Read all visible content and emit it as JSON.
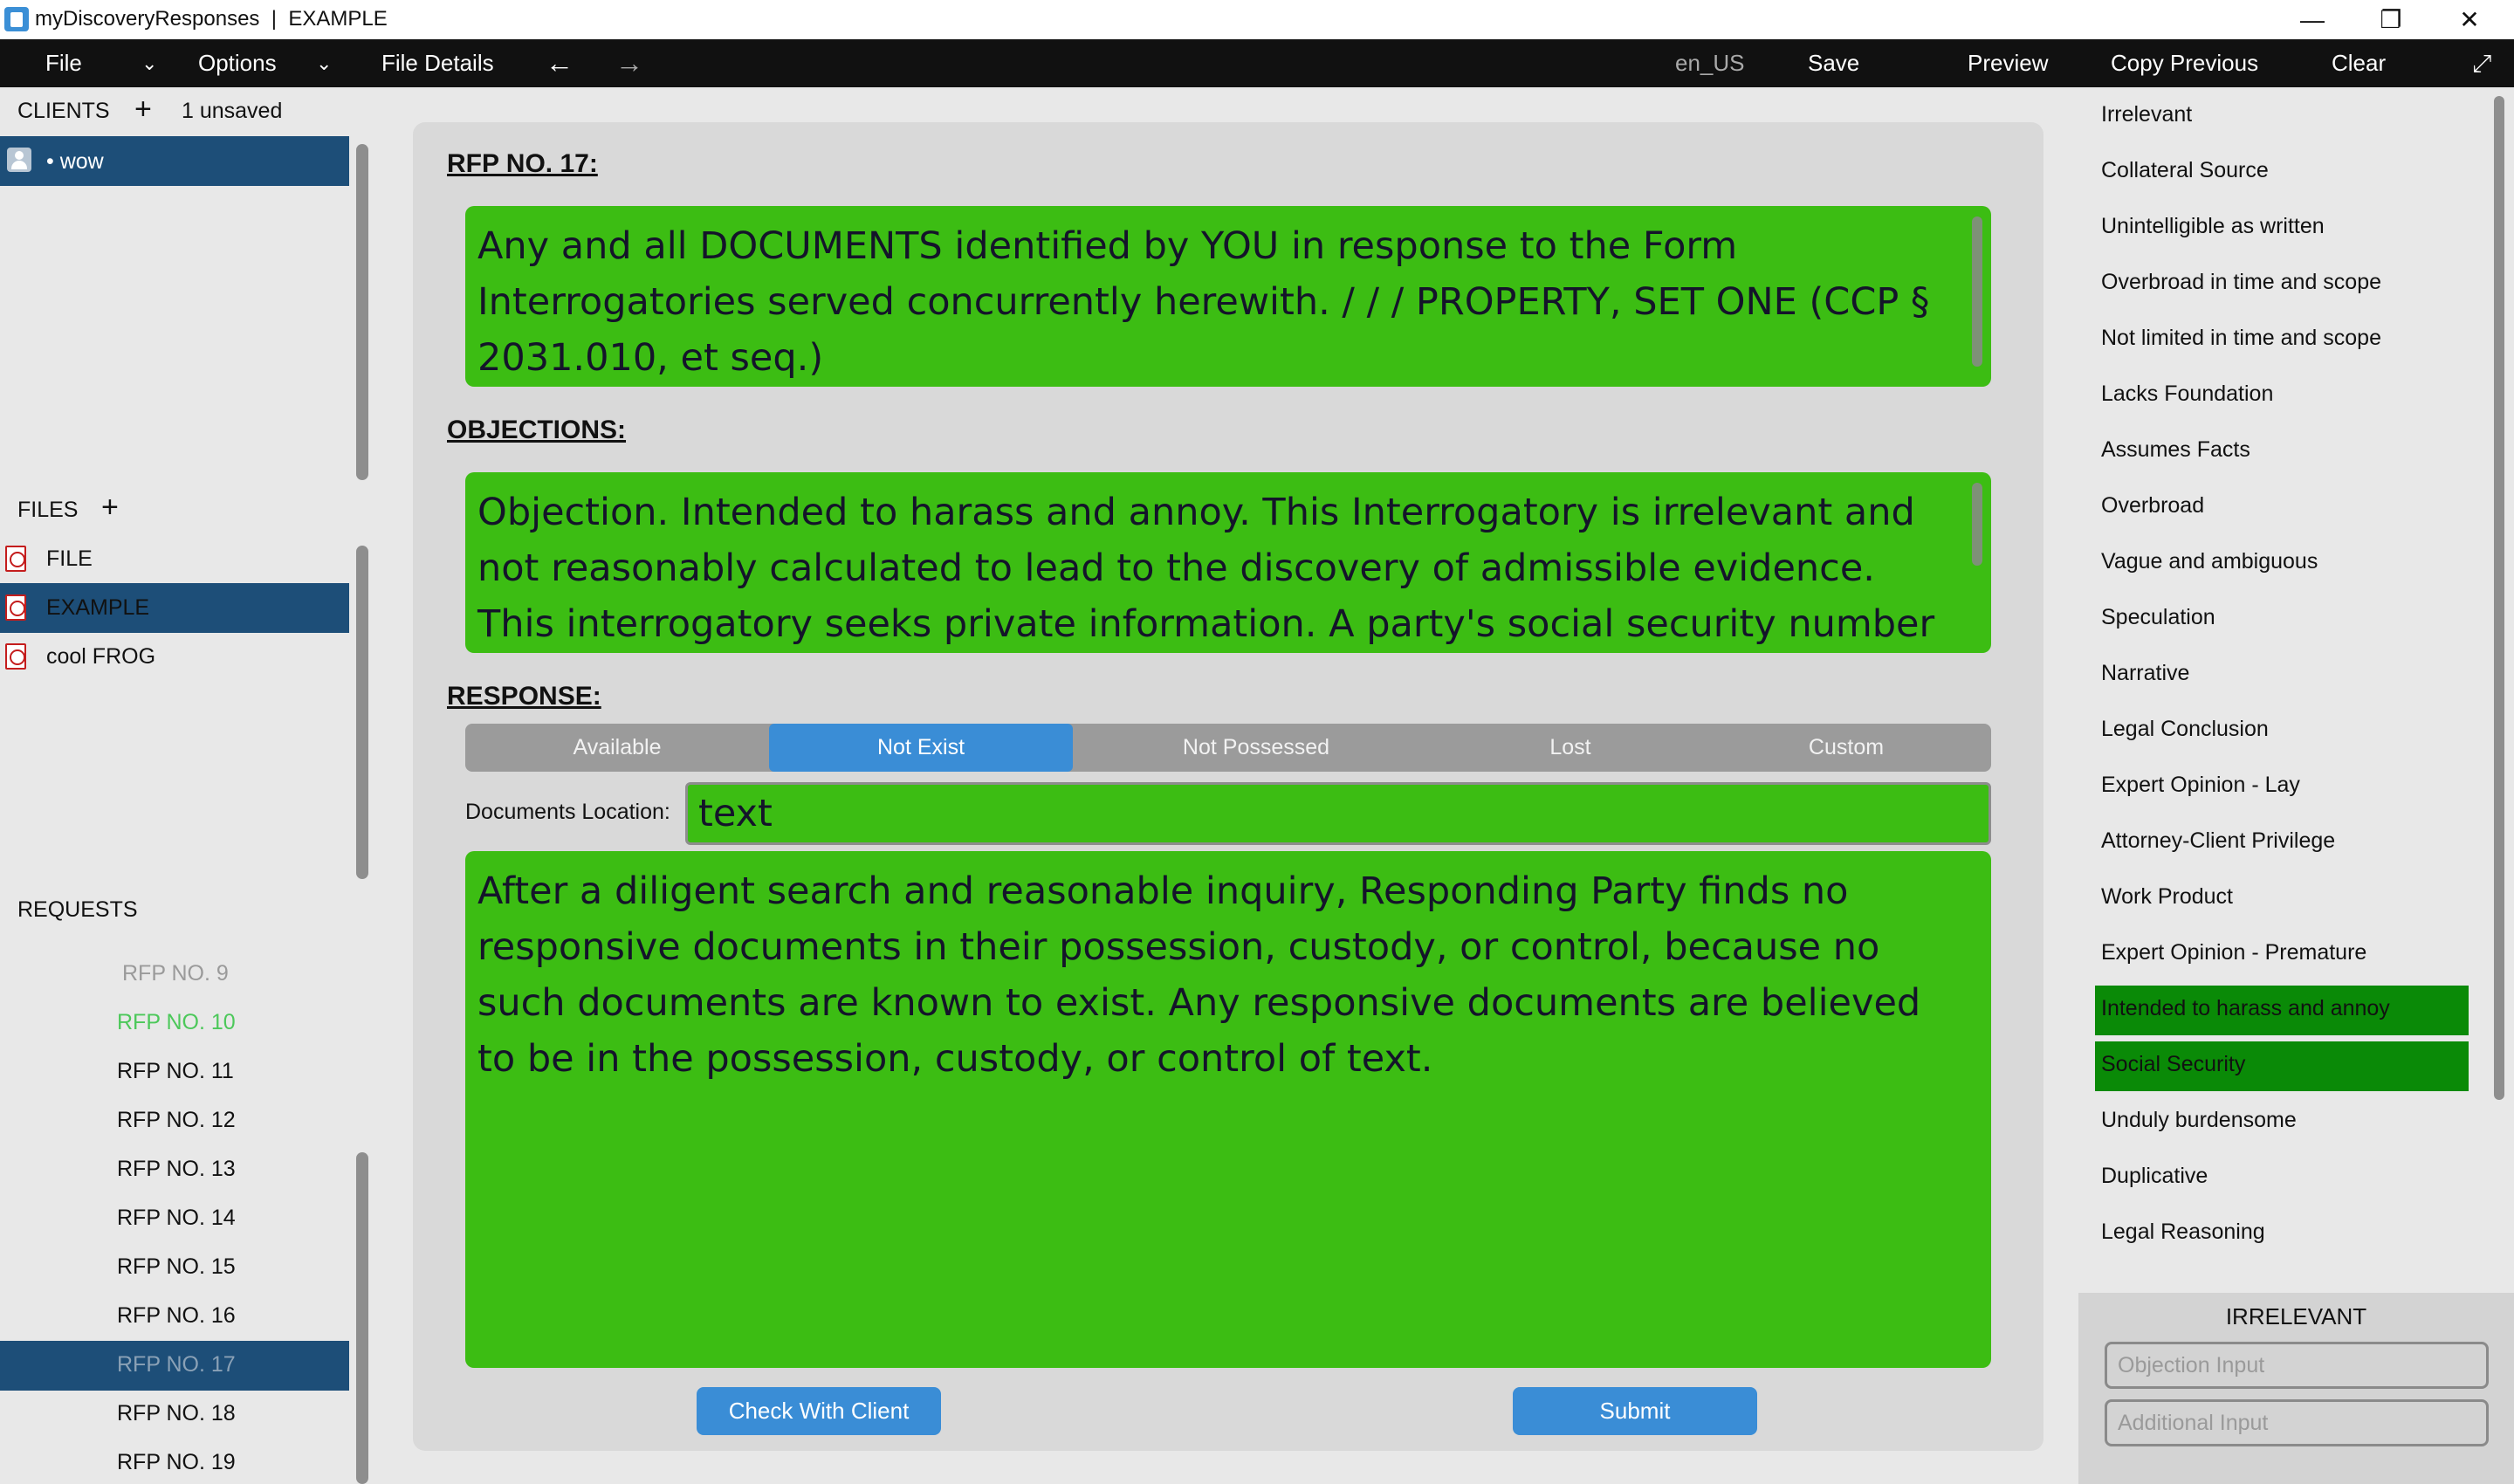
{
  "window": {
    "title": "myDiscoveryResponses  |  EXAMPLE",
    "minimize": "—",
    "maximize": "❐",
    "close": "✕"
  },
  "menubar": {
    "file": "File",
    "options": "Options",
    "file_details": "File Details",
    "back_arrow": "←",
    "forward_arrow": "→",
    "locale": "en_US",
    "save": "Save",
    "preview": "Preview",
    "copy_previous": "Copy Previous",
    "clear": "Clear",
    "expand": "⤢",
    "chevron": "⌄"
  },
  "clients": {
    "header": "CLIENTS",
    "add": "+",
    "unsaved": "1 unsaved",
    "items": [
      {
        "label": "• wow",
        "selected": true
      }
    ]
  },
  "files": {
    "header": "FILES",
    "add": "+",
    "items": [
      {
        "label": "FILE",
        "selected": false
      },
      {
        "label": "EXAMPLE",
        "selected": true
      },
      {
        "label": "cool FROG",
        "selected": false
      }
    ]
  },
  "requests": {
    "header": "REQUESTS",
    "items": [
      {
        "label": "RFP NO. 9",
        "state": "dim"
      },
      {
        "label": "RFP NO. 10",
        "state": "done"
      },
      {
        "label": "RFP NO. 11",
        "state": "normal"
      },
      {
        "label": "RFP NO. 12",
        "state": "normal"
      },
      {
        "label": "RFP NO. 13",
        "state": "normal"
      },
      {
        "label": "RFP NO. 14",
        "state": "normal"
      },
      {
        "label": "RFP NO. 15",
        "state": "normal"
      },
      {
        "label": "RFP NO. 16",
        "state": "normal"
      },
      {
        "label": "RFP NO. 17",
        "state": "selected"
      },
      {
        "label": "RFP NO. 18",
        "state": "normal"
      },
      {
        "label": "RFP NO. 19",
        "state": "normal"
      }
    ]
  },
  "main": {
    "rfp_heading": "RFP NO. 17:",
    "request_text": "Any and all DOCUMENTS identified by YOU in response to the Form Interrogatories served concurrently herewith. / / / PROPERTY, SET ONE (CCP § 2031.010, et seq.)",
    "objections_heading": "OBJECTIONS:",
    "objections_text": "Objection. Intended to harass and annoy. This Interrogatory is irrelevant and not reasonably calculated to lead to the discovery of admissible evidence. This interrogatory seeks private information. A party's social security number is",
    "response_heading": "RESPONSE:",
    "response_options": [
      "Available",
      "Not Exist",
      "Not Possessed",
      "Lost",
      "Custom"
    ],
    "active_option": "Not Exist",
    "documents_location_label": "Documents Location:",
    "documents_location_value": "text",
    "response_text": "After a diligent search and reasonable inquiry, Responding Party finds no responsive documents in their possession, custody, or control, because no such documents are known to exist. Any responsive documents are believed to be in the possession, custody, or control of text.",
    "check_with_client": "Check With Client",
    "submit": "Submit"
  },
  "objections_list": {
    "items": [
      {
        "label": "Irrelevant",
        "active": false
      },
      {
        "label": "Collateral Source",
        "active": false
      },
      {
        "label": "Unintelligible as written",
        "active": false
      },
      {
        "label": "Overbroad in time and scope",
        "active": false
      },
      {
        "label": "Not limited in time and scope",
        "active": false
      },
      {
        "label": "Lacks Foundation",
        "active": false
      },
      {
        "label": "Assumes Facts",
        "active": false
      },
      {
        "label": "Overbroad",
        "active": false
      },
      {
        "label": "Vague and ambiguous",
        "active": false
      },
      {
        "label": "Speculation",
        "active": false
      },
      {
        "label": "Narrative",
        "active": false
      },
      {
        "label": "Legal Conclusion",
        "active": false
      },
      {
        "label": "Expert Opinion - Lay",
        "active": false
      },
      {
        "label": "Attorney-Client Privilege",
        "active": false
      },
      {
        "label": "Work Product",
        "active": false
      },
      {
        "label": "Expert Opinion - Premature",
        "active": false
      },
      {
        "label": "Intended to harass and annoy",
        "active": true
      },
      {
        "label": "Social Security",
        "active": true
      },
      {
        "label": "Unduly burdensome",
        "active": false
      },
      {
        "label": "Duplicative",
        "active": false
      },
      {
        "label": "Legal Reasoning",
        "active": false
      }
    ],
    "selected_title": "IRRELEVANT",
    "objection_input_placeholder": "Objection Input",
    "additional_input_placeholder": "Additional Input"
  },
  "colors": {
    "accent_blue": "#3a8dd6",
    "selection_navy": "#1d4e78",
    "response_green": "#3cbd13",
    "active_objection_green": "#0a8a07",
    "done_request_green": "#4cc85a"
  }
}
